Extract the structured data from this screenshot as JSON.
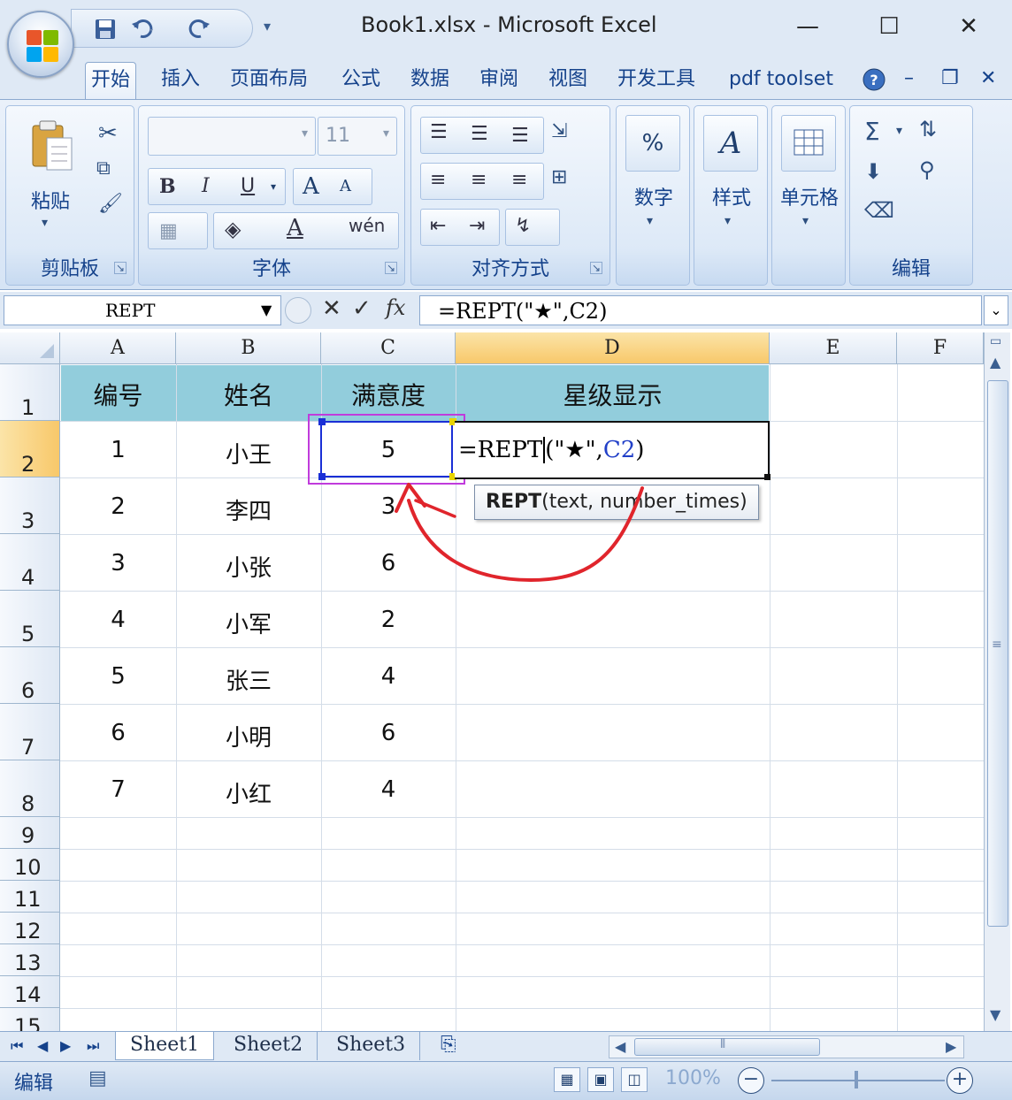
{
  "window": {
    "title": "Book1.xlsx  -  Microsoft Excel",
    "minimize": "—",
    "maximize": "☐",
    "close": "✕"
  },
  "qat": {
    "save_icon": "save-icon",
    "undo_icon": "undo-icon",
    "redo_icon": "redo-icon",
    "more": "▾"
  },
  "tabs": [
    {
      "label": "开始",
      "active": true
    },
    {
      "label": "插入"
    },
    {
      "label": "页面布局"
    },
    {
      "label": "公式"
    },
    {
      "label": "数据"
    },
    {
      "label": "审阅"
    },
    {
      "label": "视图"
    },
    {
      "label": "开发工具"
    },
    {
      "label": "pdf toolset"
    }
  ],
  "ribbon": {
    "clipboard": {
      "label": "剪贴板",
      "paste": "粘贴"
    },
    "font": {
      "label": "字体",
      "size": "11",
      "bold": "B",
      "italic": "I",
      "underline": "U",
      "grow": "A",
      "shrink": "A",
      "phonetic": "wén"
    },
    "alignment": {
      "label": "对齐方式"
    },
    "number": {
      "label": "数字",
      "symbol": "%"
    },
    "styles": {
      "label": "样式",
      "symbol": "A"
    },
    "cells": {
      "label": "单元格"
    },
    "editing": {
      "label": "编辑",
      "sum": "Σ"
    }
  },
  "formula_bar": {
    "name_box": "REPT",
    "fx": "fx",
    "formula": "=REPT(\"★\",C2)"
  },
  "grid": {
    "columns": [
      "A",
      "B",
      "C",
      "D",
      "E",
      "F"
    ],
    "selected_column": "D",
    "rows": [
      "1",
      "2",
      "3",
      "4",
      "5",
      "6",
      "7",
      "8",
      "9",
      "10",
      "11",
      "12",
      "13",
      "14",
      "15"
    ],
    "selected_row": "2",
    "header": [
      "编号",
      "姓名",
      "满意度",
      "星级显示"
    ],
    "header_fill": "#92cddc",
    "data": [
      [
        "1",
        "小王",
        "5"
      ],
      [
        "2",
        "李四",
        "3"
      ],
      [
        "3",
        "小张",
        "6"
      ],
      [
        "4",
        "小军",
        "2"
      ],
      [
        "5",
        "张三",
        "4"
      ],
      [
        "6",
        "小明",
        "6"
      ],
      [
        "7",
        "小红",
        "4"
      ]
    ],
    "edit_cell": {
      "prefix": "=REPT",
      "middle": "(\"★\",",
      "ref": "C2",
      "suffix": ")"
    },
    "tooltip": {
      "func": "REPT",
      "args": "(text, number_times)"
    },
    "annotation_color": "#e0252c"
  },
  "sheets": [
    {
      "label": "Sheet1",
      "active": true
    },
    {
      "label": "Sheet2"
    },
    {
      "label": "Sheet3"
    }
  ],
  "status": {
    "mode": "编辑",
    "zoom": "100%"
  }
}
